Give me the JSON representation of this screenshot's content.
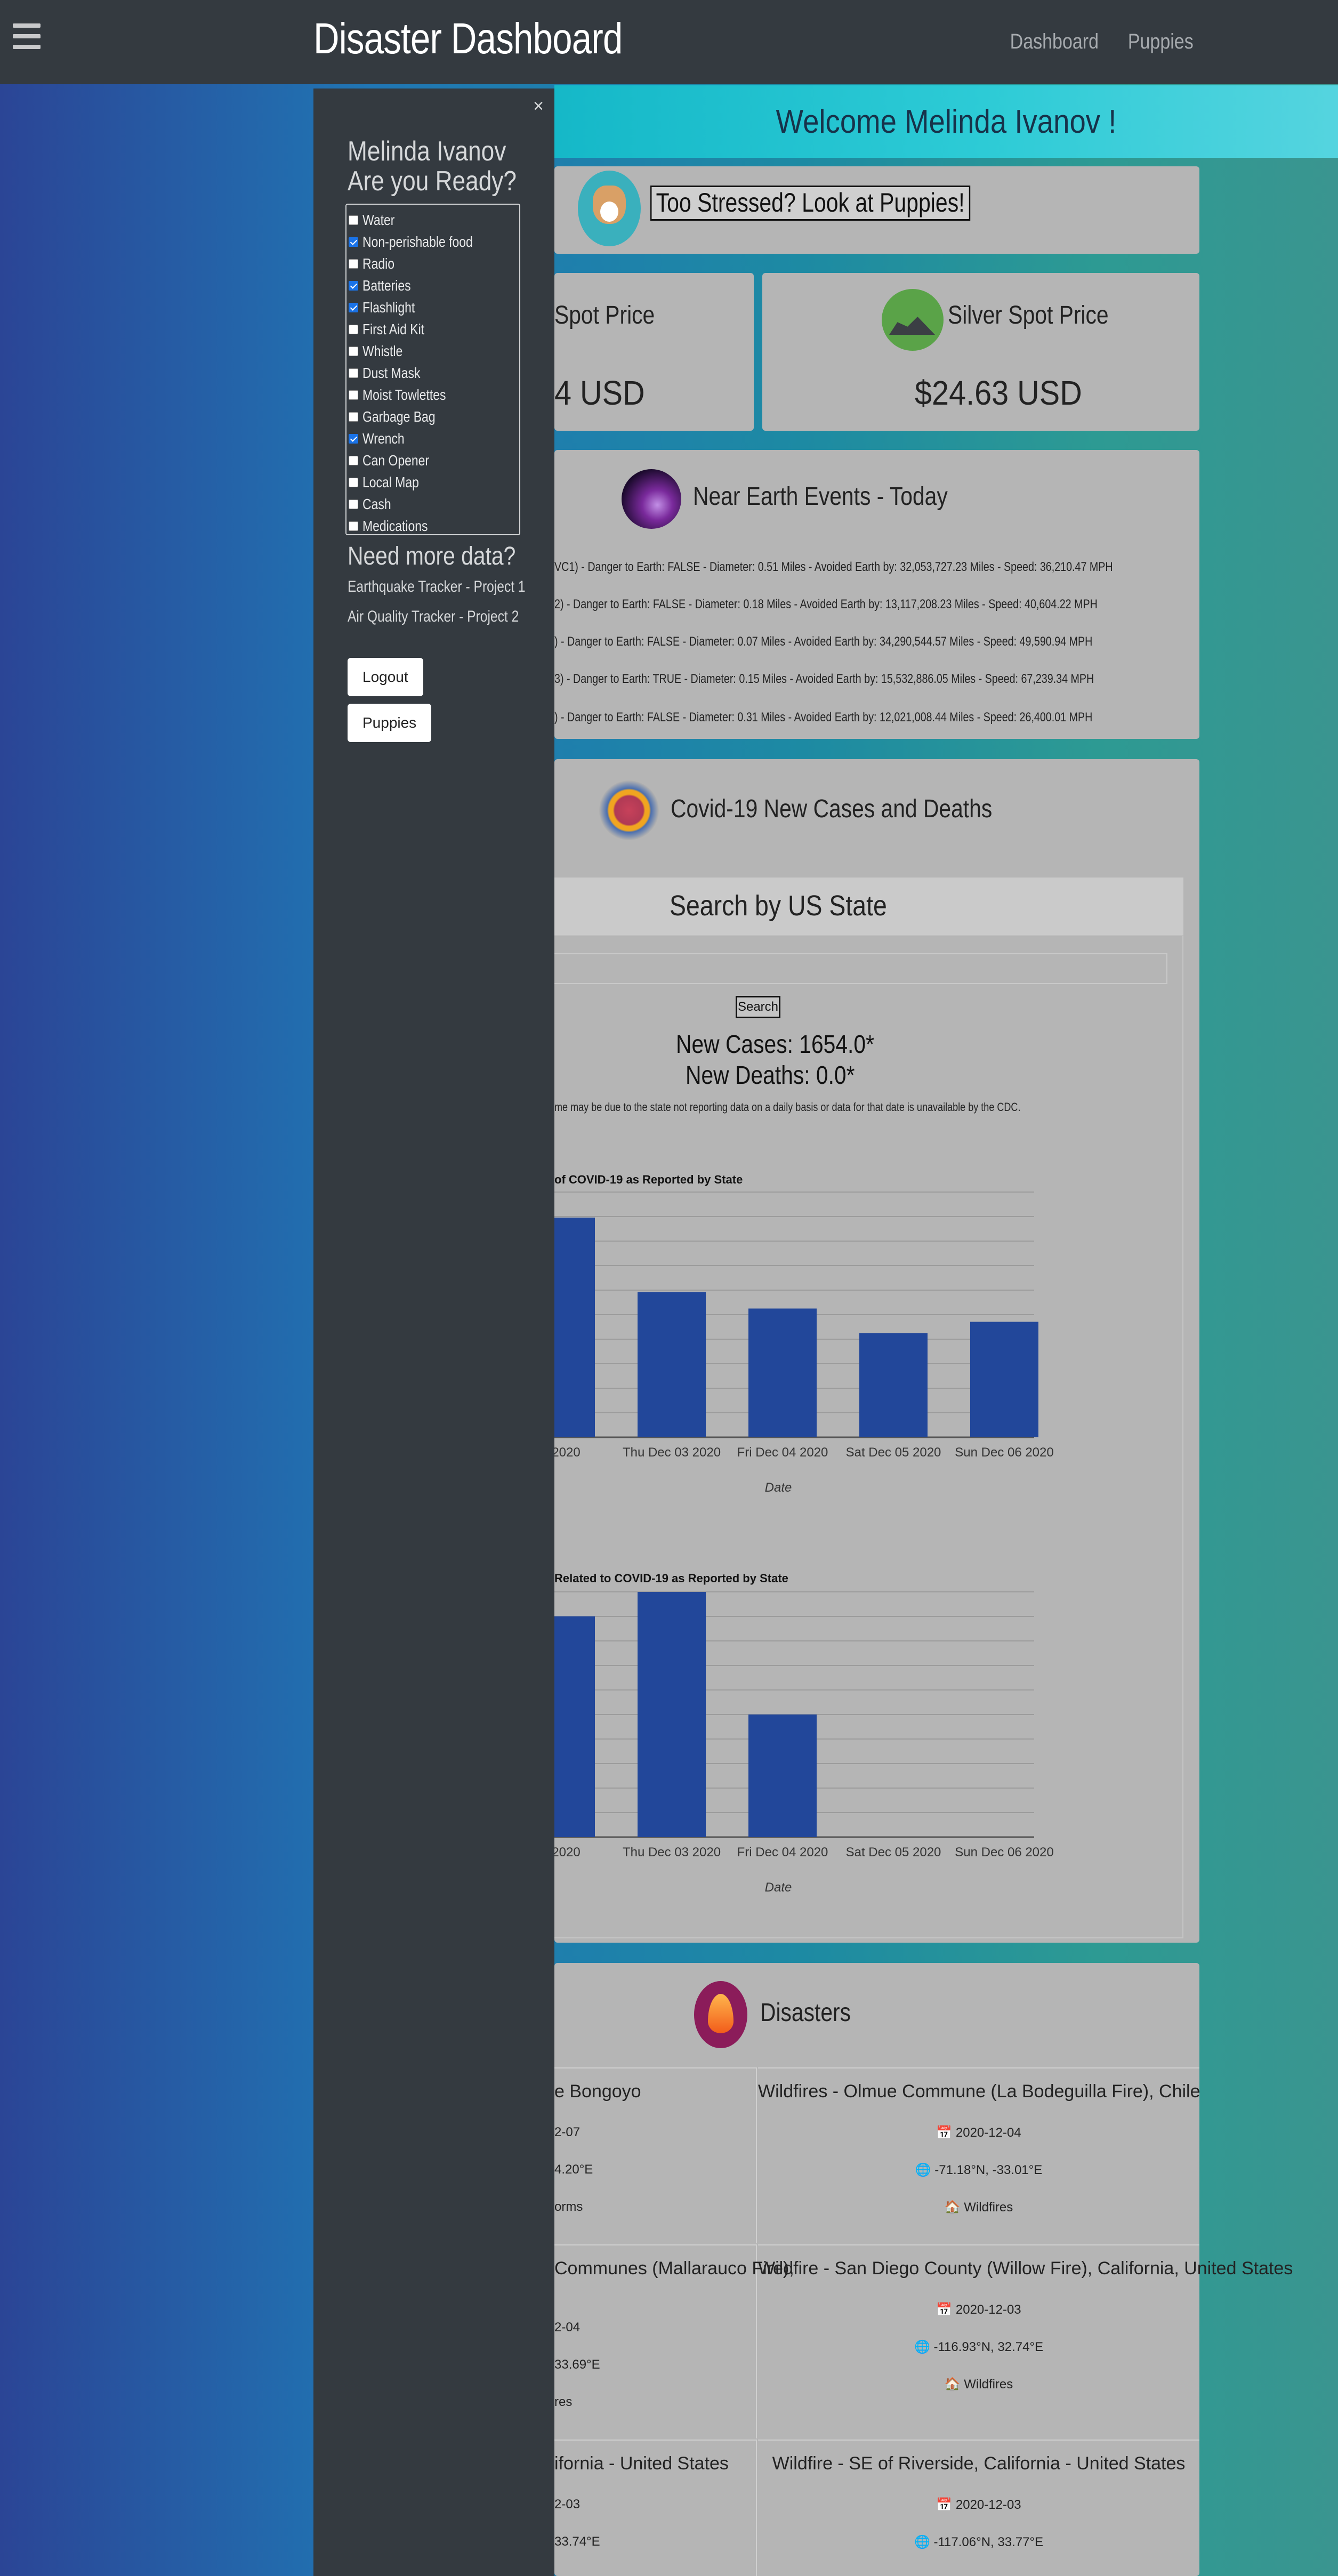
{
  "navbar": {
    "brand": "Disaster Dashboard",
    "links": [
      "Dashboard",
      "Puppies"
    ]
  },
  "welcome": "Welcome Melinda Ivanov !",
  "puppies_card": {
    "button": "Too Stressed? Look at Puppies!"
  },
  "gold": {
    "title": "Spot Price",
    "value": "4 USD"
  },
  "silver": {
    "title": "Silver Spot Price",
    "value": "$24.63 USD"
  },
  "neo": {
    "title": "Near Earth Events - Today",
    "lines": [
      "VC1) - Danger to Earth: FALSE - Diameter: 0.51 Miles - Avoided Earth by: 32,053,727.23 Miles - Speed: 36,210.47 MPH",
      "2) - Danger to Earth: FALSE - Diameter: 0.18 Miles - Avoided Earth by: 13,117,208.23 Miles - Speed: 40,604.22 MPH",
      ") - Danger to Earth: FALSE - Diameter: 0.07 Miles - Avoided Earth by: 34,290,544.57 Miles - Speed: 49,590.94 MPH",
      "3) - Danger to Earth: TRUE - Diameter: 0.15 Miles - Avoided Earth by: 15,532,886.05 Miles - Speed: 67,239.34 MPH",
      ") - Danger to Earth: FALSE - Diameter: 0.31 Miles - Avoided Earth by: 12,021,008.44 Miles - Speed: 26,400.01 MPH"
    ]
  },
  "covid": {
    "title": "Covid-19 New Cases and Deaths",
    "search_header": "Search by US State",
    "search_button": "Search",
    "new_cases": "New Cases: 1654.0*",
    "new_deaths": "New Deaths: 0.0*",
    "note": "me may be due to the state not reporting data on a daily basis or data for that date is unavailable by the CDC."
  },
  "chart_data": [
    {
      "type": "bar",
      "title": "of COVID-19 as Reported by State",
      "categories": [
        "2 2020",
        "Thu Dec 03 2020",
        "Fri Dec 04 2020",
        "Sat Dec 05 2020",
        "Sun Dec 06 2020"
      ],
      "values": [
        2150,
        1420,
        1260,
        1020,
        1130
      ],
      "ylim": [
        0,
        2400
      ],
      "xlabel": "Date",
      "ylabel": "",
      "color": "#22479a",
      "grid": true
    },
    {
      "type": "bar",
      "title": "Related to COVID-19 as Reported by State",
      "categories": [
        "2 2020",
        "Thu Dec 03 2020",
        "Fri Dec 04 2020",
        "Sat Dec 05 2020",
        "Sun Dec 06 2020"
      ],
      "values": [
        9,
        10,
        5,
        0,
        0
      ],
      "ylim": [
        0,
        10
      ],
      "xlabel": "Date",
      "ylabel": "",
      "color": "#22479a",
      "grid": true
    }
  ],
  "disasters": {
    "title": "Disasters",
    "items": [
      {
        "title": "e Bongoyo",
        "date": "2-07",
        "coords": "4.20°E",
        "type": "orms"
      },
      {
        "title": "Wildfires - Olmue Commune (La Bodeguilla Fire), Chile",
        "date": "2020-12-04",
        "coords": "-71.18°N, -33.01°E",
        "type": "Wildfires"
      },
      {
        "title": "Communes (Mallarauco Fire),",
        "date": "2-04",
        "coords": "33.69°E",
        "type": "res"
      },
      {
        "title": "Wildfire - San Diego County (Willow Fire), California, United States",
        "date": "2020-12-03",
        "coords": "-116.93°N, 32.74°E",
        "type": "Wildfires"
      },
      {
        "title": "ifornia - United States",
        "date": "2-03",
        "coords": "33.74°E",
        "type": ""
      },
      {
        "title": "Wildfire - SE of Riverside, California - United States",
        "date": "2020-12-03",
        "coords": "-117.06°N, 33.77°E",
        "type": ""
      }
    ]
  },
  "sidebar": {
    "name": "Melinda Ivanov",
    "question": "Are you Ready?",
    "checklist": [
      {
        "label": "Water",
        "checked": false
      },
      {
        "label": "Non-perishable food",
        "checked": true
      },
      {
        "label": "Radio",
        "checked": false
      },
      {
        "label": "Batteries",
        "checked": true
      },
      {
        "label": "Flashlight",
        "checked": true
      },
      {
        "label": "First Aid Kit",
        "checked": false
      },
      {
        "label": "Whistle",
        "checked": false
      },
      {
        "label": "Dust Mask",
        "checked": false
      },
      {
        "label": "Moist Towlettes",
        "checked": false
      },
      {
        "label": "Garbage Bag",
        "checked": false
      },
      {
        "label": "Wrench",
        "checked": true
      },
      {
        "label": "Can Opener",
        "checked": false
      },
      {
        "label": "Local Map",
        "checked": false
      },
      {
        "label": "Cash",
        "checked": false
      },
      {
        "label": "Medications",
        "checked": false
      }
    ],
    "more_data": "Need more data?",
    "links": [
      "Earthquake Tracker - Project 1",
      "Air Quality Tracker - Project 2"
    ],
    "logout": "Logout",
    "puppies": "Puppies"
  }
}
